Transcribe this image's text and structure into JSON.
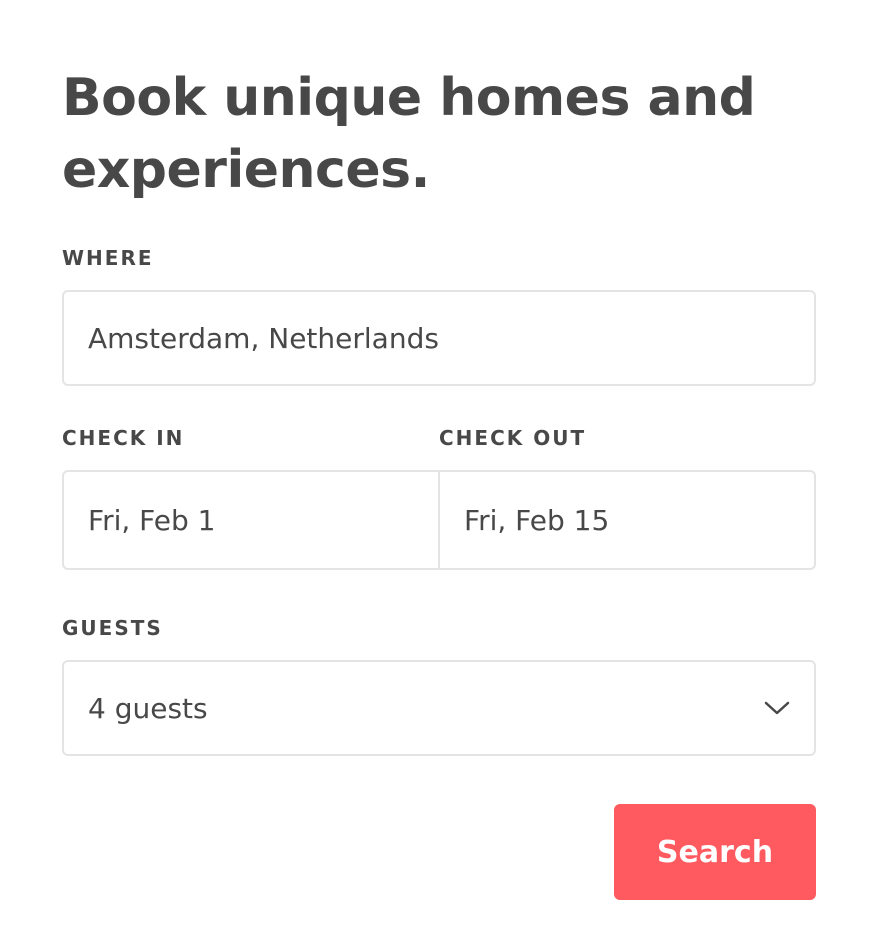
{
  "form": {
    "title": "Book unique homes and experiences.",
    "where": {
      "label": "WHERE",
      "value": "Amsterdam, Netherlands"
    },
    "check_in": {
      "label": "CHECK IN",
      "value": "Fri, Feb 1"
    },
    "check_out": {
      "label": "CHECK OUT",
      "value": "Fri, Feb 15"
    },
    "guests": {
      "label": "GUESTS",
      "value": "4 guests",
      "icon": "chevron-down-icon"
    },
    "search_label": "Search"
  },
  "colors": {
    "accent": "#ff5a5f",
    "text": "#484848",
    "border": "#e4e4e4"
  }
}
